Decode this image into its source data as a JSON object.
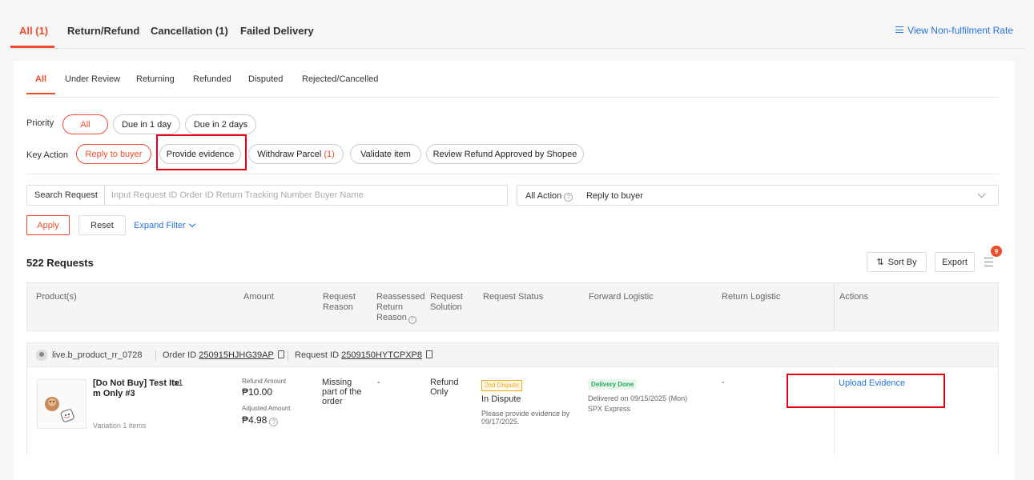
{
  "top_tabs": [
    "All (1)",
    "Return/Refund",
    "Cancellation (1)",
    "Failed Delivery"
  ],
  "view_nonfulfilment": "View Non-fulfilment Rate",
  "sub_tabs": [
    "All",
    "Under Review",
    "Returning",
    "Refunded",
    "Disputed",
    "Rejected/Cancelled"
  ],
  "priority": {
    "label": "Priority",
    "options": [
      "All",
      "Due in 1 day",
      "Due in 2 days"
    ]
  },
  "key_action": {
    "label": "Key Action",
    "options": [
      "Reply to buyer",
      "Provide evidence",
      "Withdraw Parcel",
      "Validate item",
      "Review Refund Approved by Shopee"
    ],
    "withdraw_count": "(1)"
  },
  "search": {
    "label": "Search Request",
    "placeholder": "Input Request ID Order ID Return Tracking Number Buyer Name"
  },
  "action_filter": {
    "label": "All Action",
    "value": "Reply to buyer"
  },
  "buttons": {
    "apply": "Apply",
    "reset": "Reset",
    "expand": "Expand Filter",
    "sort": "Sort By",
    "export": "Export"
  },
  "request_count": "522 Requests",
  "menu_badge": "9",
  "table": {
    "headers": {
      "product": "Product(s)",
      "amount": "Amount",
      "reason_1": "Request",
      "reason_2": "Reason",
      "reassessed_1": "Reassessed",
      "reassessed_2": "Return",
      "reassessed_3": "Reason",
      "solution_1": "Request",
      "solution_2": "Solution",
      "status": "Request Status",
      "forward": "Forward Logistic",
      "return": "Return Logistic",
      "actions": "Actions"
    }
  },
  "order": {
    "buyer": "live.b_product_rr_0728",
    "order_label": "Order ID",
    "order_id": "250915HJHG39AP",
    "request_label": "Request ID",
    "request_id": "2509150HYTCPXP8",
    "product_line1": "[Do Not Buy] Test Ite",
    "product_line2": "m Only #3",
    "qty": "x1",
    "variation": "Variation 1 items",
    "refund_amount_label": "Refund Amount",
    "refund_amount": "₱10.00",
    "adjusted_amount_label": "Adjusted Amount",
    "adjusted_amount": "₱4.98",
    "reason_1": "Missing",
    "reason_2": "part of the",
    "reason_3": "order",
    "reassessed": "-",
    "solution_1": "Refund",
    "solution_2": "Only",
    "status_tag": "2nd Dispute",
    "status": "In Dispute",
    "status_note_1": "Please provide evidence by",
    "status_note_2": "09/17/2025.",
    "forward_tag": "Delivery Done",
    "forward_date": "Delivered on 09/15/2025 (Mon)",
    "forward_carrier": "SPX Express",
    "return_logistic": "-",
    "action": "Upload Evidence"
  }
}
